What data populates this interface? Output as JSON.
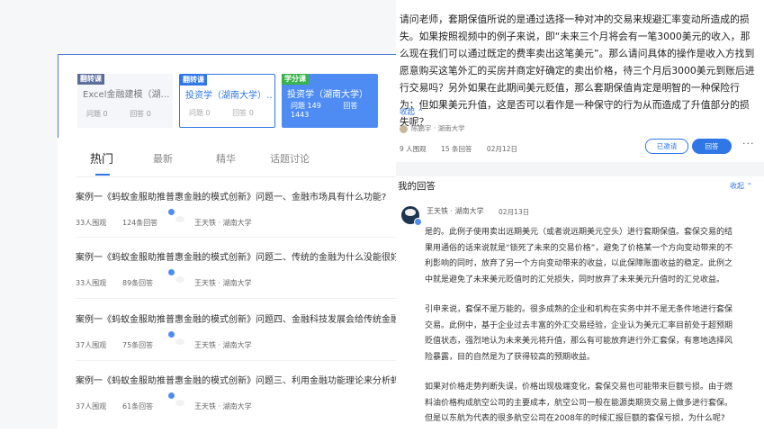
{
  "courses": [
    {
      "tag": "翻转课",
      "name": "Excel金融建模（湖…",
      "questions_label": "问题 0",
      "answers_label": "回答 0"
    },
    {
      "tag": "翻转课",
      "name": "投资学（湖南大学）…",
      "questions_label": "问题 0",
      "answers_label": "回答 0"
    },
    {
      "tag": "学分课",
      "name": "投资学（湖南大学）",
      "questions_label": "问题 149",
      "answers_label": "回答 1443"
    }
  ],
  "tabs": [
    "热门",
    "最新",
    "精华",
    "话题讨论"
  ],
  "questions": [
    {
      "title": "案例一《蚂蚁金服助推普惠金融的模式创新》问题一、金融市场具有什么功能?",
      "views": "33人围观",
      "answers": "124条回答",
      "author": "王天铁 · 湖南大学"
    },
    {
      "title": "案例一《蚂蚁金服助推普惠金融的模式创新》问题二、传统的金融为什么没能很好的解",
      "views": "33人围观",
      "answers": "89条回答",
      "author": "王天铁 · 湖南大学"
    },
    {
      "title": "案例一《蚂蚁金服助推普惠金融的模式创新》问题四、金融科技发展会给传统金融带来",
      "views": "37人围观",
      "answers": "75条回答",
      "author": "王天铁 · 湖南大学"
    },
    {
      "title": "案例一《蚂蚁金服助推普惠金融的模式创新》问题三、利用金融功能理论来分析蚂蚁金",
      "views": "37人围观",
      "answers": "61条回答",
      "author": "王天铁 · 湖南大学"
    }
  ],
  "detail": {
    "question_text": "请问老师，套期保值所说的是通过选择一种对冲的交易来规避汇率变动所造成的损失。如果按照视频中的例子来说，即“未来三个月将会有一笔3000美元的收入，那么现在我们可以通过既定的费率卖出这笔美元”。那么请问具体的操作是收入方找到愿意购买这笔外汇的买房并商定好确定的卖出价格，待三个月后3000美元到账后进行交易吗？另外如果在此期间美元贬值，那么套期保值肯定是明智的一种保险行为；但如果美元升值，这是否可以看作是一种保守的行为从而造成了升值部分的损失呢？",
    "collapse_label": "收起",
    "asker": "陈鹏宇 · 湖南大学",
    "views": "9 人围观",
    "answers": "15 条回答",
    "date": "02月12日",
    "invited_label": "已邀请",
    "answer_label": "回答",
    "more_label": "···"
  },
  "my_answer": {
    "heading": "我的回答",
    "collapse_label": "收起",
    "author": "王天铁 · 湖南大学",
    "date": "02月13日",
    "paragraphs": [
      "是的。此例子使用卖出远期美元（或者说远期美元空头）进行套期保值。套保交易的结果用通俗的话来说就是“锁死了未来的交易价格”，避免了价格某一个方向变动带来的不利影响的同时，放弃了另一个方向变动带来的收益，以此保障账面收益的稳定。此例之中就是避免了未来美元贬值时的汇兑损失，同时放弃了未来美元升值时的汇兑收益。",
      "引申来说，套保不是万能的。很多成熟的企业和机构在实务中并不是无条件地进行套保交易。此例中，基于企业过去丰富的外汇交易经验，企业认为美元汇率目前处于超预期贬值状态，强烈地认为未来美元将升值，那么有可能放弃进行外汇套保，有意地选择风险暴露，目的自然是为了获得较高的预期收益。",
      "如果对价格走势判断失误，价格出现极端变化，套保交易也可能带来巨额亏损。由于燃料油价格构成航空公司的主要成本，航空公司一般在能源类期货交易上做多进行套保。但是以东航为代表的很多航空公司在2008年的时候汇报巨额的套保亏损，为什么呢?"
    ]
  }
}
